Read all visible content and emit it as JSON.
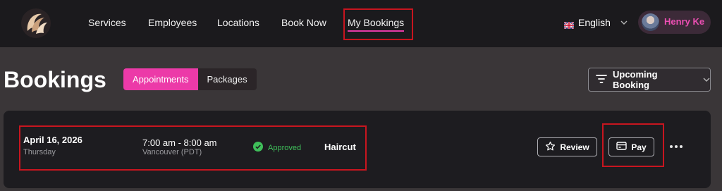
{
  "nav": {
    "items": [
      {
        "label": "Services"
      },
      {
        "label": "Employees"
      },
      {
        "label": "Locations"
      },
      {
        "label": "Book Now"
      },
      {
        "label": "My Bookings",
        "active": true
      }
    ],
    "language": "English",
    "user_name": "Henry Ke"
  },
  "page": {
    "title": "Bookings",
    "tabs": [
      {
        "label": "Appointments",
        "active": true
      },
      {
        "label": "Packages",
        "active": false
      }
    ],
    "filter_label": "Upcoming Booking"
  },
  "booking": {
    "date": "April 16, 2026",
    "weekday": "Thursday",
    "time": "7:00 am - 8:00 am",
    "timezone": "Vancouver (PDT)",
    "status": "Approved",
    "service": "Haircut",
    "review_label": "Review",
    "pay_label": "Pay"
  },
  "colors": {
    "accent": "#ec3aa8",
    "status_approved": "#3fbf5a",
    "highlight": "#c8151f"
  },
  "icons": {
    "logo": "brand-logo",
    "flag": "uk-flag-icon",
    "filter": "filter-lines-icon",
    "status": "check-circle-icon",
    "review": "star-icon",
    "pay": "credit-card-icon",
    "more": "more-horizontal-icon"
  }
}
